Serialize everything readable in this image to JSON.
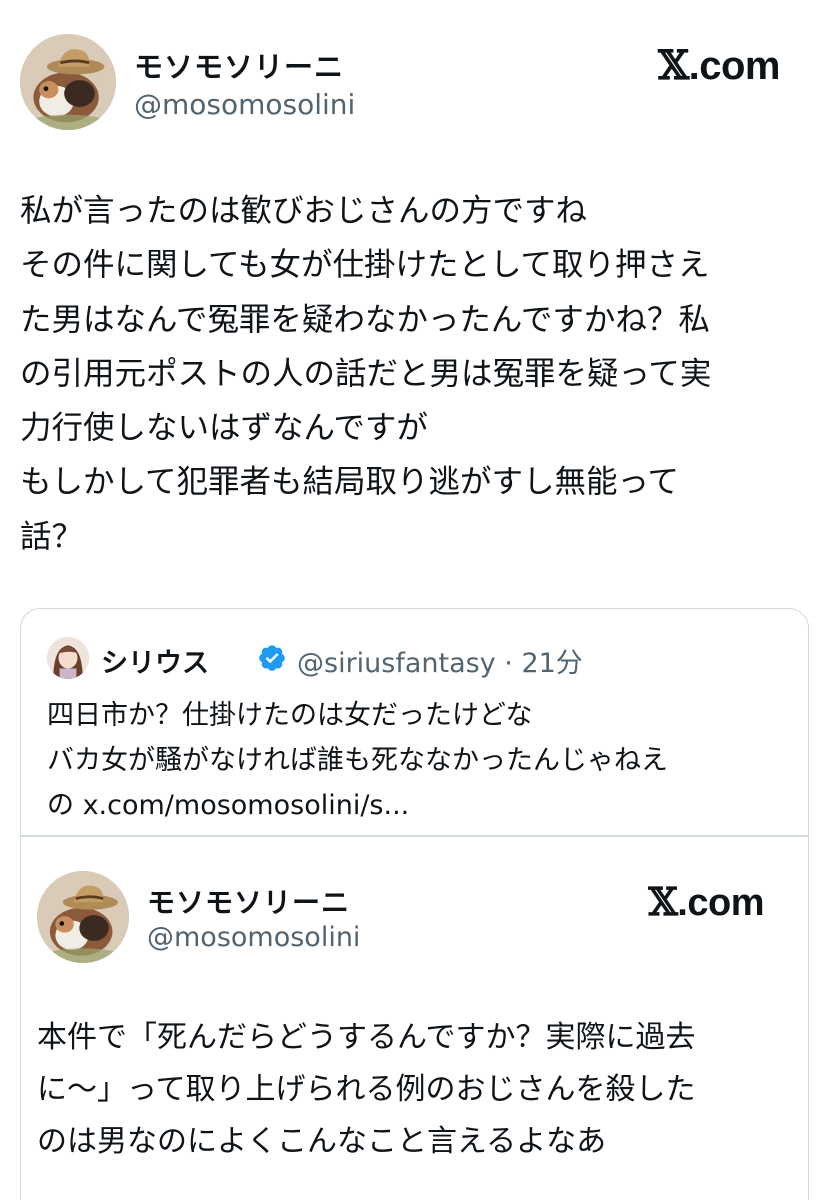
{
  "post": {
    "author": {
      "display_name": "モソモソリーニ",
      "handle": "@mosomosolini"
    },
    "brand": "X.com",
    "text_lines": [
      "私が言ったのは歓びおじさんの方ですね",
      "その件に関しても女が仕掛けたとして取り押さえ",
      "た男はなんで冤罪を疑わなかったんですかね？私",
      "の引用元ポストの人の話だと男は冤罪を疑って実",
      "力行使しないはずなんですが",
      "もしかして犯罪者も結局取り逃がすし無能って",
      "話？"
    ]
  },
  "quoted": {
    "author": {
      "display_name": "シリウス",
      "handle": "@siriusfantasy",
      "verified": true
    },
    "separator": "·",
    "time": "21分",
    "meta": "@siriusfantasy · 21分",
    "text_lines": [
      "四日市か？仕掛けたのは女だったけどな",
      "バカ女が騒がなければ誰も死ななかったんじゃねえ",
      "の x.com/mosomosolini/s..."
    ],
    "embedded": {
      "author": {
        "display_name": "モソモソリーニ",
        "handle": "@mosomosolini"
      },
      "brand": "X.com",
      "text_lines": [
        "本件で「死んだらどうするんですか？実際に過去",
        "に〜」って取り上げられる例のおじさんを殺した",
        "のは男なのによくこんなこと言えるよなあ"
      ]
    }
  },
  "icons": {
    "verified_badge": "verified-checkmark-icon",
    "brand_logo": "x-logo-icon"
  },
  "colors": {
    "text": "#0f1419",
    "secondary": "#536471",
    "border": "#cfd9de",
    "verified": "#1d9bf0"
  }
}
